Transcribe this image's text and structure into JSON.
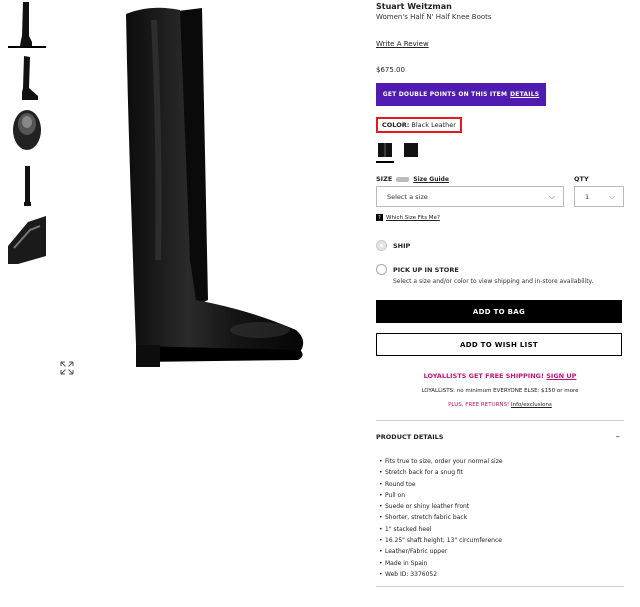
{
  "product": {
    "brand": "Stuart Weitzman",
    "name": "Women's Half N' Half Knee Boots",
    "review_link": "Write A Review",
    "price": "$675.00"
  },
  "promo": {
    "text": "GET DOUBLE POINTS ON THIS ITEM",
    "link": "DETAILS",
    "color": "#4f1bb0"
  },
  "color_selector": {
    "label": "COLOR:",
    "value": "Black Leather",
    "highlight_color": "#e01b22"
  },
  "size": {
    "label": "SIZE",
    "guide_link": "Size Guide",
    "placeholder": "Select a size",
    "fit_link": "Which Size Fits Me?"
  },
  "qty": {
    "label": "QTY",
    "value": "1"
  },
  "shipping": {
    "ship_label": "SHIP",
    "pickup_label": "PICK UP IN STORE",
    "pickup_desc": "Select a size and/or color to view shipping and in-store availability."
  },
  "buttons": {
    "add_to_bag": "ADD TO BAG",
    "add_to_wishlist": "ADD TO WISH LIST"
  },
  "loyalty": {
    "headline": "LOYALLISTS GET FREE SHIPPING!",
    "signup": "SIGN UP",
    "sub": "LOYALLISTS: no minimum EVERYONE ELSE: $150 or more",
    "returns": "PLUS, FREE RETURNS!",
    "exclusions": "Info/exclusions",
    "accent_color": "#c0147a"
  },
  "details": {
    "heading": "PRODUCT DETAILS",
    "toggle": "–",
    "items": [
      "Fits true to size, order your normal size",
      "Stretch back for a snug fit",
      "Round toe",
      "Pull on",
      "Suede or shiny leather front",
      "Shorter, stretch fabric back",
      "1\" stacked heel",
      "16.25\" shaft height; 13\" circumference",
      "Leather/Fabric upper",
      "Made in Spain",
      "Web ID: 3376052"
    ]
  },
  "icons": {
    "zoom": "expand-arrows-icon",
    "size_guide": "ruler-icon",
    "fit_help": "question-icon",
    "dropdown": "chevron-down-icon"
  }
}
